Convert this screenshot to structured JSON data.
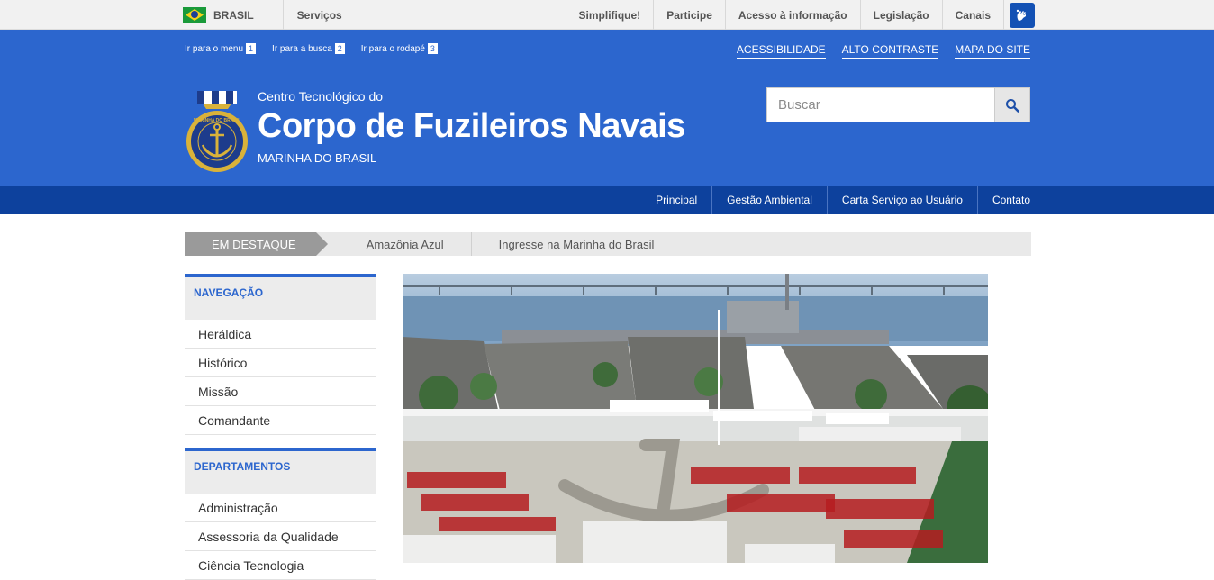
{
  "gov_bar": {
    "country": "BRASIL",
    "services": "Serviços",
    "links": [
      "Simplifique!",
      "Participe",
      "Acesso à informação",
      "Legislação",
      "Canais"
    ]
  },
  "header": {
    "skip_links": [
      {
        "label": "Ir para o menu",
        "num": "1"
      },
      {
        "label": "Ir para a busca",
        "num": "2"
      },
      {
        "label": "Ir para o rodapé",
        "num": "3"
      }
    ],
    "access_links": [
      "ACESSIBILIDADE",
      "ALTO CONTRASTE",
      "MAPA DO SITE"
    ],
    "org_small": "Centro Tecnológico do",
    "org_name": "Corpo de Fuzileiros Navais",
    "org_sub": "MARINHA DO BRASIL",
    "search_placeholder": "Buscar",
    "logo_text": "MARINHA DO BRASIL"
  },
  "main_nav": [
    "Principal",
    "Gestão Ambiental",
    "Carta Serviço ao Usuário",
    "Contato"
  ],
  "destaque": {
    "label": "EM DESTAQUE",
    "items": [
      "Amazônia Azul",
      "Ingresse na Marinha do Brasil"
    ]
  },
  "sidebar": {
    "navegacao": {
      "title": "NAVEGAÇÃO",
      "items": [
        "Heráldica",
        "Histórico",
        "Missão",
        "Comandante"
      ]
    },
    "departamentos": {
      "title": "DEPARTAMENTOS",
      "items": [
        "Administração",
        "Assessoria da Qualidade",
        "Ciência Tecnologia"
      ]
    }
  },
  "colors": {
    "header_blue": "#2c66ce",
    "nav_blue": "#0d419d",
    "gov_bar": "#f1f1f1"
  },
  "icons": [
    "brazil-flag-icon",
    "vlibras-hands-icon",
    "search-icon",
    "navy-crest-logo"
  ]
}
